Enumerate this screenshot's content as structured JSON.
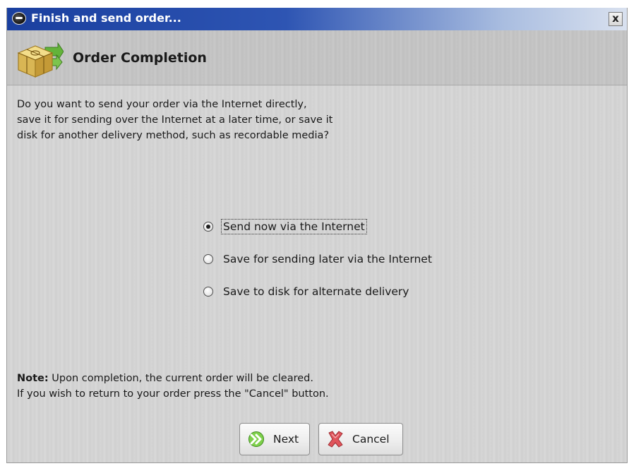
{
  "window": {
    "title": "Finish and send order...",
    "close_label": "x"
  },
  "header": {
    "title": "Order Completion",
    "icon": "package-icon"
  },
  "question": {
    "lines": [
      "Do you want to send your order via the Internet directly,",
      "save it for sending over the Internet at a later time, or save it",
      "disk for another delivery method, such as recordable media?"
    ]
  },
  "options": [
    {
      "label": "Send now via the Internet",
      "selected": true
    },
    {
      "label": "Save for sending later via the Internet",
      "selected": false
    },
    {
      "label": "Save to disk for alternate delivery",
      "selected": false
    }
  ],
  "note": {
    "prefix": "Note:",
    "line1": " Upon completion, the current order will be cleared.",
    "line2": "If you wish to return to your order press the \"Cancel\" button."
  },
  "buttons": {
    "next_label": "Next",
    "next_icon": "double-arrow-right-icon",
    "cancel_label": "Cancel",
    "cancel_icon": "red-x-icon"
  },
  "colors": {
    "titlebar": "#1a3f9f",
    "next_icon": "#5fb830",
    "cancel_icon": "#d9424a"
  }
}
